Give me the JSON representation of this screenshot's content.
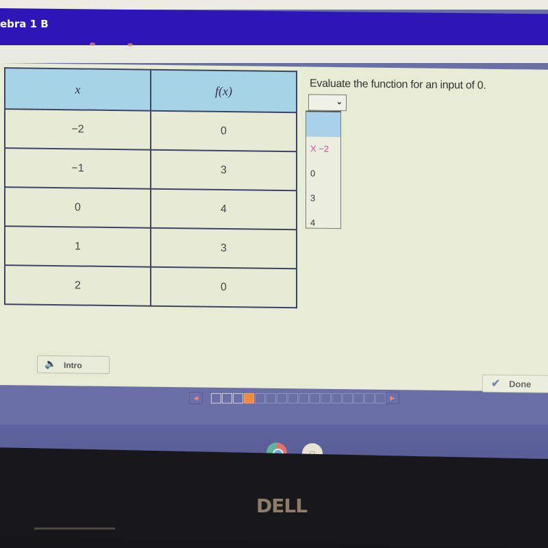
{
  "header": {
    "course_title": "ebra 1 B",
    "brand_color": "#2c16b8"
  },
  "table": {
    "headers": [
      "x",
      "f(x)"
    ],
    "rows": [
      {
        "x": "−2",
        "fx": "0"
      },
      {
        "x": "−1",
        "fx": "3"
      },
      {
        "x": "0",
        "fx": "4"
      },
      {
        "x": "1",
        "fx": "3"
      },
      {
        "x": "2",
        "fx": "0"
      }
    ],
    "header_color": "#a7d3e6"
  },
  "question": {
    "prompt": "Evaluate the function for an input of 0.",
    "select_value": "",
    "options": [
      {
        "label": "",
        "state": "highlighted"
      },
      {
        "label": "X −2",
        "state": "incorrect"
      },
      {
        "label": "0",
        "state": "normal"
      },
      {
        "label": "3",
        "state": "normal"
      },
      {
        "label": "4",
        "state": "normal"
      }
    ],
    "incorrect_color": "#d04d90"
  },
  "controls": {
    "intro_label": "Intro",
    "intro_icon": "speaker-icon",
    "done_label": "Done",
    "done_icon": "checkmark-icon"
  },
  "pager": {
    "current_page": 4,
    "total_pages": 16,
    "completed_pages": 3,
    "prev_icon": "triangle-left-icon",
    "next_icon": "triangle-right-icon",
    "current_color": "#ef8a3f"
  },
  "shelf": {
    "apps": [
      {
        "name": "Chrome",
        "icon": "chrome-icon",
        "active": true
      },
      {
        "name": "App",
        "icon": "app-icon",
        "active": false
      }
    ]
  },
  "device": {
    "brand": "DELL"
  }
}
